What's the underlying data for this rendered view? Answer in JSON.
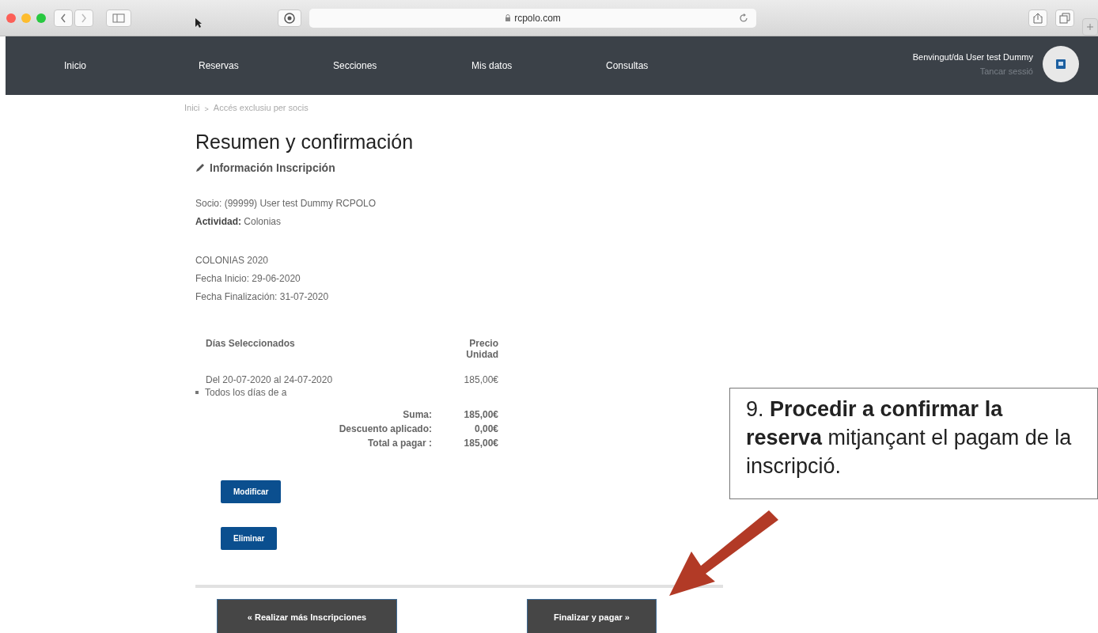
{
  "browser": {
    "url": "rcpolo.com"
  },
  "nav": {
    "items": [
      {
        "label": "Inicio"
      },
      {
        "label": "Reservas"
      },
      {
        "label": "Secciones"
      },
      {
        "label": "Mis datos"
      },
      {
        "label": "Consultas"
      }
    ],
    "greeting": "Benvingut/da User test Dummy",
    "logout": "Tancar sessió"
  },
  "breadcrumb": [
    "Inici",
    ">",
    "Accés exclusiu per socis"
  ],
  "title": "Resumen y confirmación",
  "section_title": "Información Inscripción",
  "member": "Socio: (99999) User test Dummy RCPOLO",
  "activity": "**Actividad:** Colonias",
  "program": "COLONIAS 2020",
  "start": "Fecha Inicio: 29-06-2020",
  "end": "Fecha Finalización: 31-07-2020",
  "table": {
    "columns": [
      "Días Seleccionados",
      "Precio Unidad"
    ],
    "rows": [
      {
        "period": "Del 20-07-2020 al 24-07-2020",
        "note": "Todos los días de a",
        "price": "185,00€"
      }
    ],
    "totals": [
      {
        "label": "Suma:",
        "value": "185,00€"
      },
      {
        "label": "Descuento aplicado:",
        "value": "0,00€"
      },
      {
        "label": "Total a pagar :",
        "value": "185,00€"
      }
    ]
  },
  "buttons": [
    "Modificar",
    "Eliminar"
  ],
  "footer_buttons": [
    "« Realizar más Inscripciones",
    "Finalizar y pagar »"
  ],
  "annotation": "9. **Procedir a confirmar la reserva** mitjançant el pagam de la inscripció."
}
